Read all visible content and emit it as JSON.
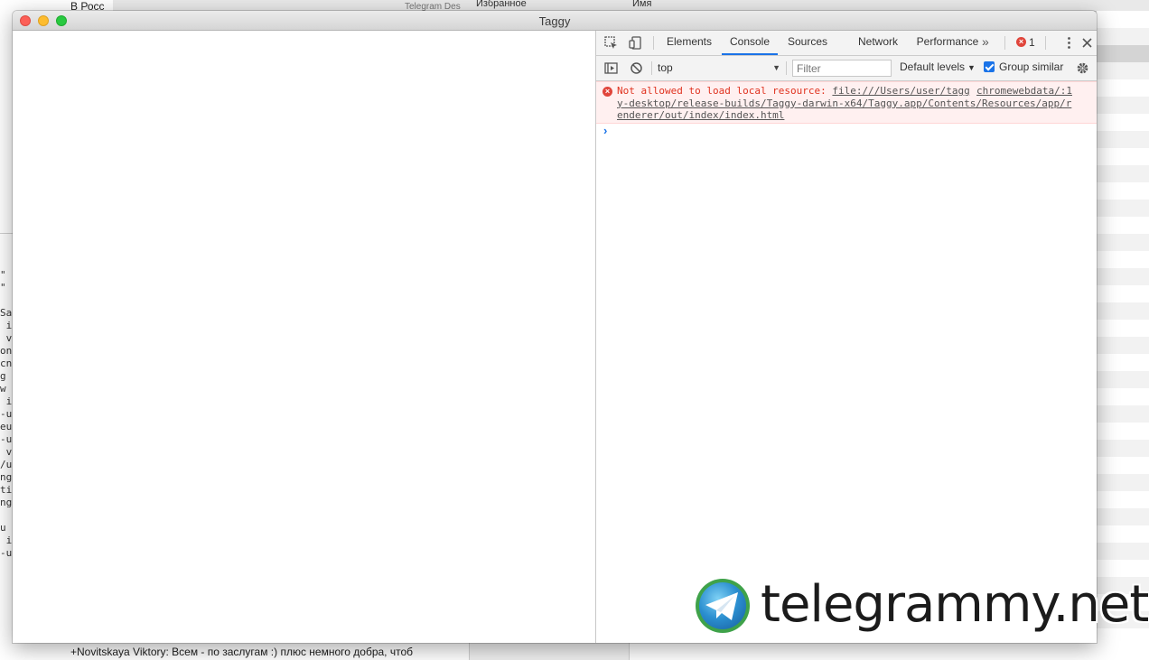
{
  "background": {
    "left_pane_text": "В Росс",
    "topbar_center": "Telegram Des",
    "topbar_favorites": "Избранное",
    "topbar_name_column": "Имя",
    "code_fragment": "\"\n\"\n\nSa\n i\n v\non\ncn\ng\nw\n i\n-u\neu\n-u\n v\n/u\nng\nti\nng\n\nu\n i\n-u",
    "bottom_message": "+Novitskaya Viktory: Всем - по заслугам :) плюс немного добра, чтоб"
  },
  "window": {
    "title": "Taggy"
  },
  "devtools": {
    "tabs": [
      "Elements",
      "Console",
      "Sources",
      "Network",
      "Performance"
    ],
    "active_tab": "Console",
    "more_tabs_glyph": "»",
    "error_count": "1",
    "toolbar": {
      "context": "top",
      "filter_placeholder": "Filter",
      "levels": "Default levels",
      "group_similar": "Group similar"
    },
    "console": {
      "error_prefix": "Not allowed to load local resource: ",
      "error_line1_link": "file:///Users/user/tagg",
      "error_line2": "y-desktop/release-builds/Taggy-darwin-x64/Taggy.app/Contents/Resources/app/r",
      "error_line3": "enderer/out/index/index.html",
      "error_source": "chromewebdata/:1",
      "prompt": "›"
    }
  },
  "watermark": {
    "text": "telegrammy.net"
  }
}
